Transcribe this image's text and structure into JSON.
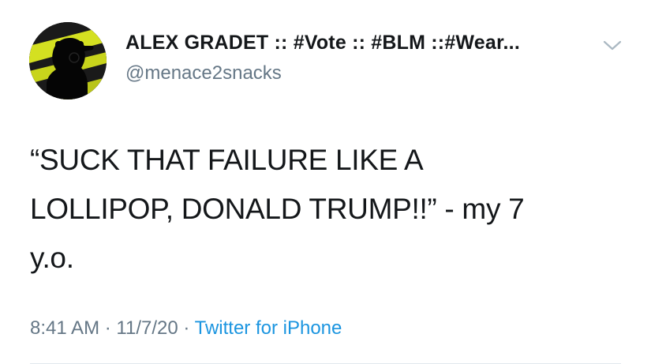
{
  "tweet": {
    "display_name": "ALEX GRADET :: #Vote :: #BLM ::#Wear...",
    "handle": "@menace2snacks",
    "text": "“SUCK THAT FAILURE LIKE A\nLOLLIPOP, DONALD TRUMP!!” - my 7\ny.o.",
    "time": "8:41 AM",
    "separator": "·",
    "date": "11/7/20",
    "source": "Twitter for iPhone"
  },
  "icons": {
    "menu": "chevron-down-icon"
  },
  "colors": {
    "text_primary": "#14171a",
    "text_secondary": "#657786",
    "link": "#1b95e0",
    "avatar_accent": "#d4e021"
  }
}
